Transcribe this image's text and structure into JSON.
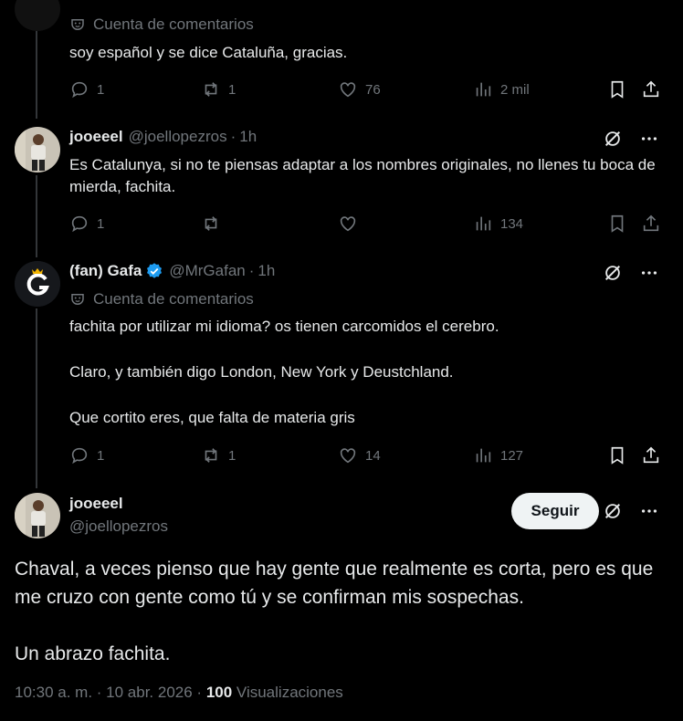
{
  "tweet0": {
    "label": "Cuenta de comentarios",
    "text": "soy español y se dice Cataluña, gracias.",
    "replies": "1",
    "retweets": "1",
    "likes": "76",
    "views": "2 mil"
  },
  "tweet1": {
    "name": "jooeeel",
    "handle": "@joellopezros",
    "time": "1h",
    "text": "Es Catalunya, si no te piensas adaptar a los nombres originales, no llenes tu boca de mierda, fachita.",
    "replies": "1",
    "retweets": "",
    "likes": "",
    "views": "134"
  },
  "tweet2": {
    "name": "(fan) Gafa",
    "handle": "@MrGafan",
    "time": "1h",
    "label": "Cuenta de comentarios",
    "p1": "fachita por utilizar mi idioma? os tienen carcomidos el cerebro.",
    "p2": "Claro, y también digo London, New York y Deustchland.",
    "p3": "Que cortito eres, que falta de materia gris",
    "replies": "1",
    "retweets": "1",
    "likes": "14",
    "views": "127"
  },
  "main": {
    "name": "jooeeel",
    "handle": "@joellopezros",
    "follow_label": "Seguir",
    "p1": "Chaval, a veces pienso que hay gente que realmente es corta, pero es que me cruzo con gente como tú y se confirman mis sospechas.",
    "p2": "Un abrazo fachita.",
    "timestamp": "10:30 a. m. · 10 abr. 2026 ·",
    "views_count": "100",
    "views_label": "Visualizaciones"
  },
  "colors": {
    "background": "#000000",
    "text": "#e7e9ea",
    "muted": "#71767b",
    "verified": "#1d9bf0",
    "thread_line": "#333639"
  }
}
